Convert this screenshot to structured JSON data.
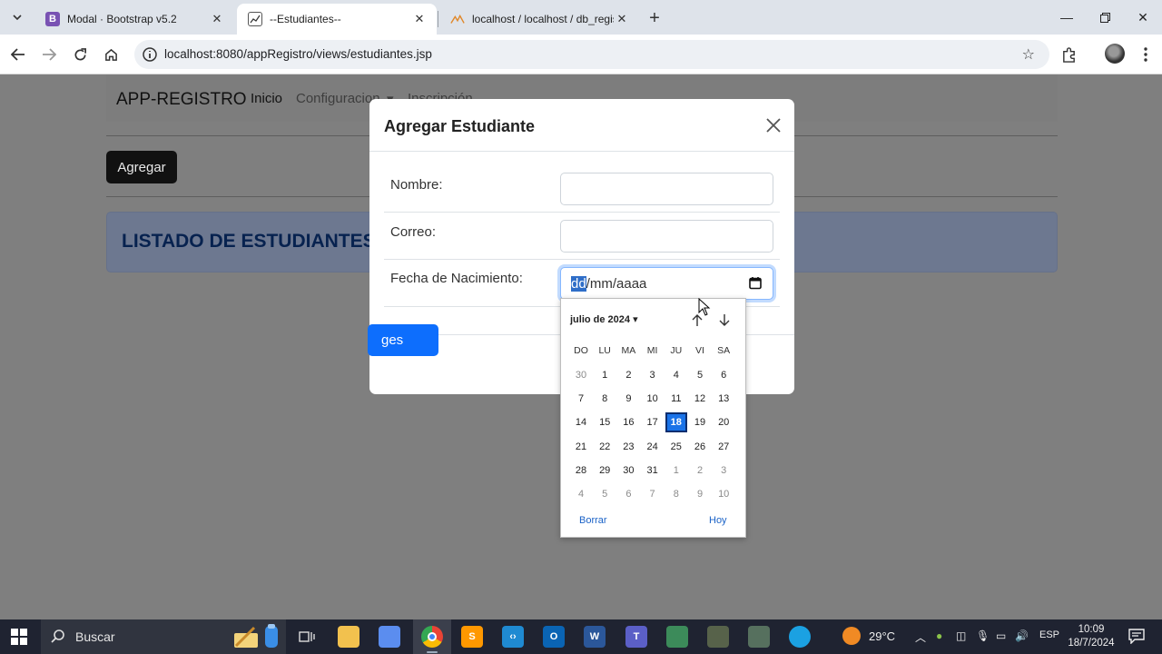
{
  "browser": {
    "tabs": [
      {
        "title": "Modal · Bootstrap v5.2",
        "favicon": "bootstrap-icon",
        "active": false
      },
      {
        "title": "--Estudiantes--",
        "favicon": "page-icon",
        "active": true
      },
      {
        "title": "localhost / localhost / db_regist",
        "favicon": "phpmyadmin-icon",
        "active": false
      }
    ],
    "url": "localhost:8080/appRegistro/views/estudiantes.jsp"
  },
  "navbar": {
    "brand": "APP-REGISTRO",
    "links": [
      "Inicio",
      "Configuracion",
      "Inscripción"
    ]
  },
  "page": {
    "add_button": "Agregar",
    "list_title": "LISTADO DE ESTUDIANTES"
  },
  "modal": {
    "title": "Agregar Estudiante",
    "fields": [
      {
        "label": "Nombre:",
        "value": ""
      },
      {
        "label": "Correo:",
        "value": ""
      },
      {
        "label": "Fecha de Nacimiento:",
        "value_selected": "dd",
        "value_rest": "/mm/aaaa"
      }
    ],
    "save_button_partial": "ges"
  },
  "datepicker": {
    "month_label": "julio de 2024",
    "weekdays": [
      "DO",
      "LU",
      "MA",
      "MI",
      "JU",
      "VI",
      "SA"
    ],
    "weeks": [
      [
        "30",
        "1",
        "2",
        "3",
        "4",
        "5",
        "6"
      ],
      [
        "7",
        "8",
        "9",
        "10",
        "11",
        "12",
        "13"
      ],
      [
        "14",
        "15",
        "16",
        "17",
        "18",
        "19",
        "20"
      ],
      [
        "21",
        "22",
        "23",
        "24",
        "25",
        "26",
        "27"
      ],
      [
        "28",
        "29",
        "30",
        "31",
        "1",
        "2",
        "3"
      ],
      [
        "4",
        "5",
        "6",
        "7",
        "8",
        "9",
        "10"
      ]
    ],
    "today": "18",
    "clear_label": "Borrar",
    "today_label": "Hoy"
  },
  "taskbar": {
    "search_placeholder": "Buscar",
    "weather": "29°C",
    "language": "ESP",
    "time": "10:09",
    "date": "18/7/2024",
    "apps": [
      "chrome-icon",
      "sublime-icon",
      "vscode-icon",
      "outlook-icon",
      "word-icon",
      "teams-icon"
    ]
  },
  "colors": {
    "primary": "#0d6efd",
    "overlay": "#7f7f7f",
    "alert_title": "#07224f",
    "taskbar": "#1f2331"
  }
}
